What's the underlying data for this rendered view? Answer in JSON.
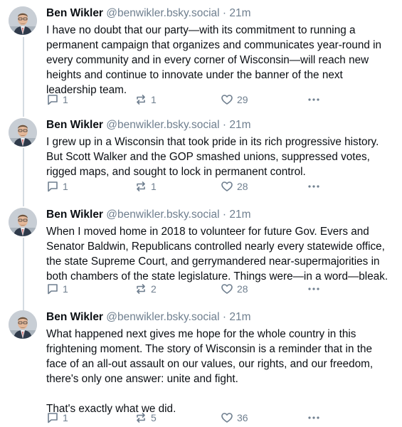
{
  "posts": [
    {
      "author_name": "Ben Wikler",
      "handle": "@benwikler.bsky.social",
      "separator": "·",
      "time": "21m",
      "text": "I have no doubt that our party—with its commitment to running a permanent campaign that organizes and communicates year-round in every community and in every corner of Wisconsin—will reach new heights and continue to innovate under the banner of the next leadership team.",
      "replies": "1",
      "reposts": "1",
      "likes": "29"
    },
    {
      "author_name": "Ben Wikler",
      "handle": "@benwikler.bsky.social",
      "separator": "·",
      "time": "21m",
      "text": "I grew up in a Wisconsin that took pride in its rich progressive history. But Scott Walker and the GOP smashed unions, suppressed votes, rigged maps, and sought to lock in permanent control.",
      "replies": "1",
      "reposts": "1",
      "likes": "28"
    },
    {
      "author_name": "Ben Wikler",
      "handle": "@benwikler.bsky.social",
      "separator": "·",
      "time": "21m",
      "text": "When I moved home in 2018 to volunteer for future Gov. Evers and Senator Baldwin, Republicans controlled nearly every statewide office, the state Supreme Court, and gerrymandered near-supermajorities in both chambers of the state legislature. Things were—in a word—bleak.",
      "replies": "1",
      "reposts": "2",
      "likes": "28"
    },
    {
      "author_name": "Ben Wikler",
      "handle": "@benwikler.bsky.social",
      "separator": "·",
      "time": "21m",
      "text": "What happened next gives me hope for the whole country in this frightening moment. The story of Wisconsin is a reminder that in the face of an all-out assault on our values, our rights, and our freedom, there's only one answer: unite and fight.\n\nThat's exactly what we did.",
      "replies": "1",
      "reposts": "5",
      "likes": "36"
    }
  ],
  "icons": {
    "reply": "reply-icon",
    "repost": "repost-icon",
    "like": "heart-icon",
    "more": "more-options-icon"
  },
  "colors": {
    "text": "#0b0f14",
    "muted": "#6f7f8f",
    "thread_line": "#d4dbe2"
  }
}
